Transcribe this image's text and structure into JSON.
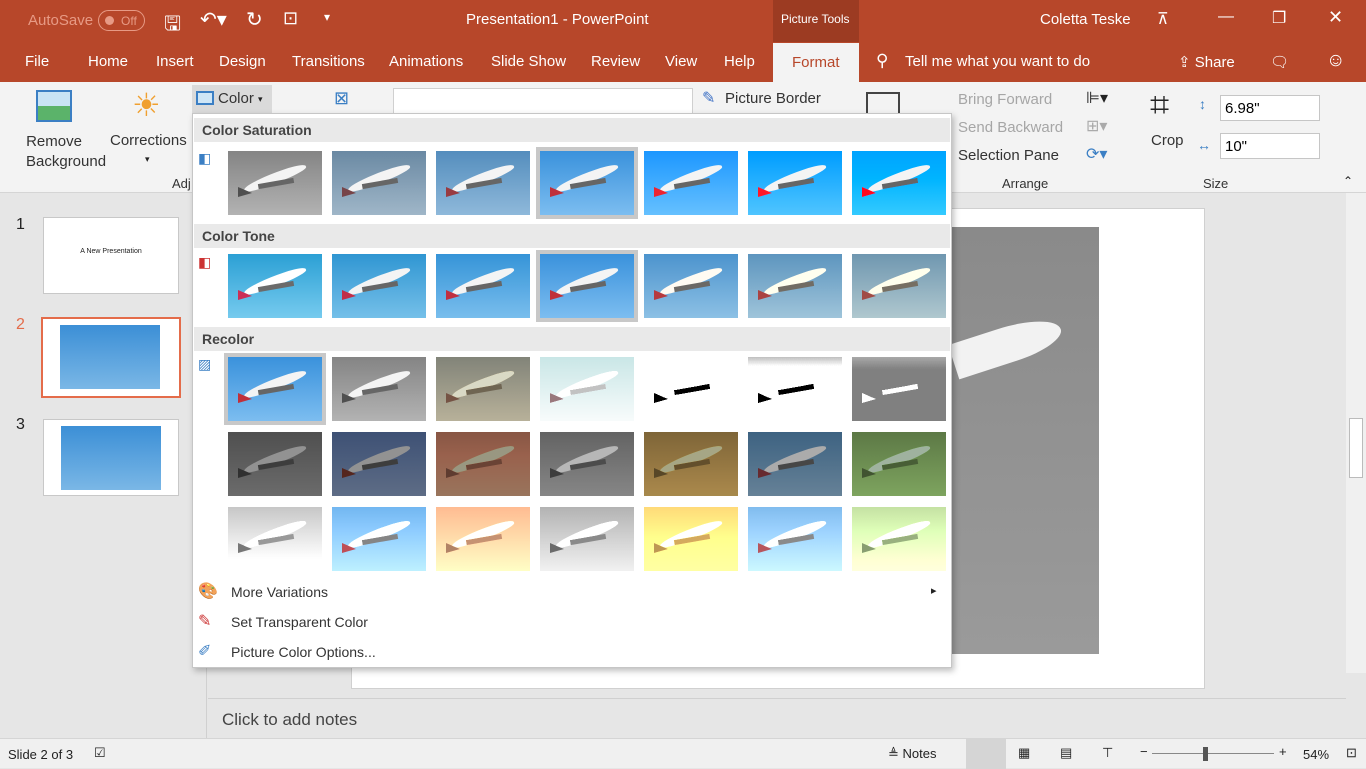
{
  "titlebar": {
    "autosave_label": "AutoSave",
    "autosave_state": "Off",
    "title": "Presentation1  -  PowerPoint",
    "context_tab": "Picture Tools",
    "user": "Coletta Teske"
  },
  "tabs": [
    {
      "label": "File"
    },
    {
      "label": "Home"
    },
    {
      "label": "Insert"
    },
    {
      "label": "Design"
    },
    {
      "label": "Transitions"
    },
    {
      "label": "Animations"
    },
    {
      "label": "Slide Show"
    },
    {
      "label": "Review"
    },
    {
      "label": "View"
    },
    {
      "label": "Help"
    },
    {
      "label": "Format",
      "active": true
    }
  ],
  "tell_me": "Tell me what you want to do",
  "share": "Share",
  "ribbon": {
    "remove_bg": "Remove Background",
    "corrections": "Corrections",
    "color": "Color",
    "adjust_group": "Adj",
    "picture_border": "Picture Border",
    "bring_forward": "Bring Forward",
    "send_backward": "Send Backward",
    "selection_pane": "Selection Pane",
    "arrange_group": "Arrange",
    "crop": "Crop",
    "height": "6.98\"",
    "width": "10\"",
    "size_group": "Size"
  },
  "dropdown": {
    "sections": [
      {
        "title": "Color Saturation",
        "tiles": 7,
        "selected": 3
      },
      {
        "title": "Color Tone",
        "tiles": 7,
        "selected": 3
      },
      {
        "title": "Recolor",
        "tiles": 21,
        "selected": 0
      }
    ],
    "menu": [
      {
        "label": "More Variations",
        "submenu": true
      },
      {
        "label": "Set Transparent Color"
      },
      {
        "label": "Picture Color Options..."
      }
    ]
  },
  "slides": [
    {
      "num": "1",
      "title": "A New Presentation"
    },
    {
      "num": "2",
      "selected": true
    },
    {
      "num": "3"
    }
  ],
  "notes_placeholder": "Click to add notes",
  "status": {
    "slide": "Slide 2 of 3",
    "notes": "Notes",
    "zoom": "54%",
    "zoom_level": 54
  },
  "colors": {
    "accent": "#b7472a",
    "selection": "#e46c4a"
  }
}
